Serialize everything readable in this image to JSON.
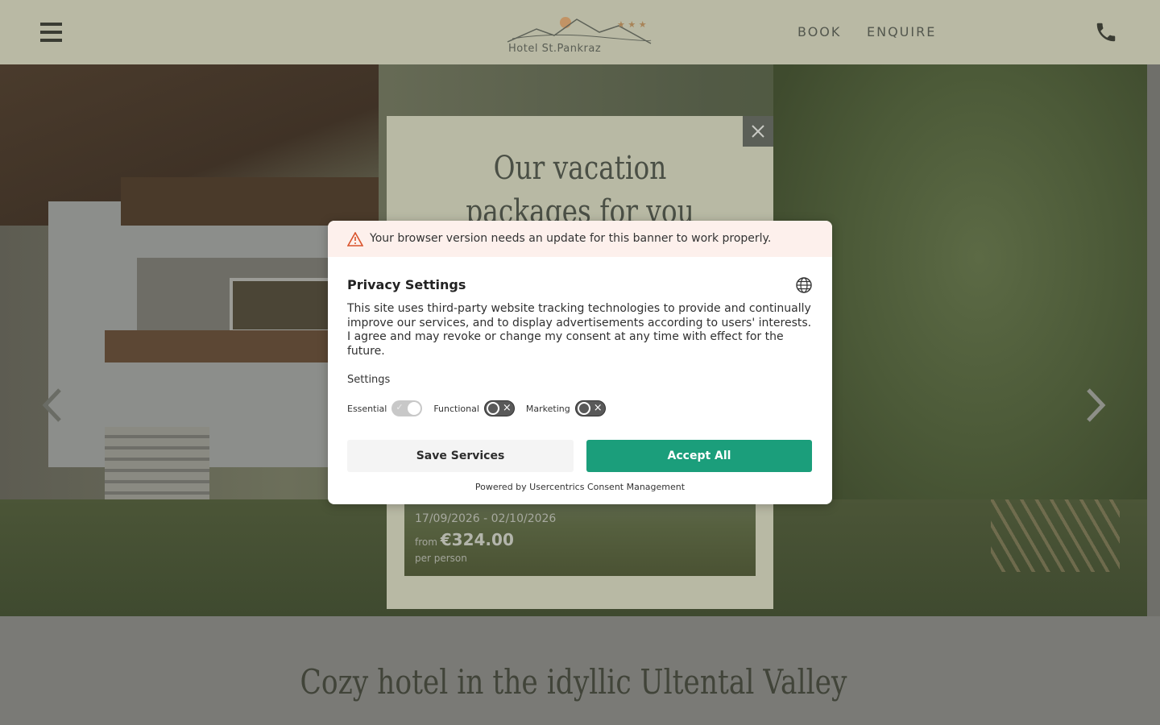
{
  "header": {
    "logo_text": "Hotel St.Pankraz",
    "nav": [
      {
        "label": "BOOK"
      },
      {
        "label": "ENQUIRE"
      }
    ],
    "icons": {
      "menu": "hamburger-menu-icon",
      "phone": "phone-icon"
    }
  },
  "packages_popup": {
    "title": "Our vacation packages for you",
    "card": {
      "dates": "17/09/2026 - 02/10/2026",
      "from_label": "from",
      "price": "€324.00",
      "per_person": "per person"
    }
  },
  "section": {
    "title": "Cozy hotel in the idyllic Ultental Valley"
  },
  "consent": {
    "warning": "Your browser version needs an update for this banner to work properly.",
    "title": "Privacy Settings",
    "description": "This site uses third-party website tracking technologies to provide and continually improve our services, and to display advertisements according to users' interests. I agree and may revoke or change my consent at any time with effect for the future.",
    "settings_label": "Settings",
    "toggles": [
      {
        "label": "Essential",
        "state": "on-disabled"
      },
      {
        "label": "Functional",
        "state": "off"
      },
      {
        "label": "Marketing",
        "state": "off"
      }
    ],
    "save_label": "Save Services",
    "accept_label": "Accept All",
    "powered_by": "Powered by Usercentrics Consent Management"
  },
  "colors": {
    "accept": "#1b9e7b",
    "header_bg": "#b9b9a4",
    "warning_bg": "#fdf0ec"
  }
}
